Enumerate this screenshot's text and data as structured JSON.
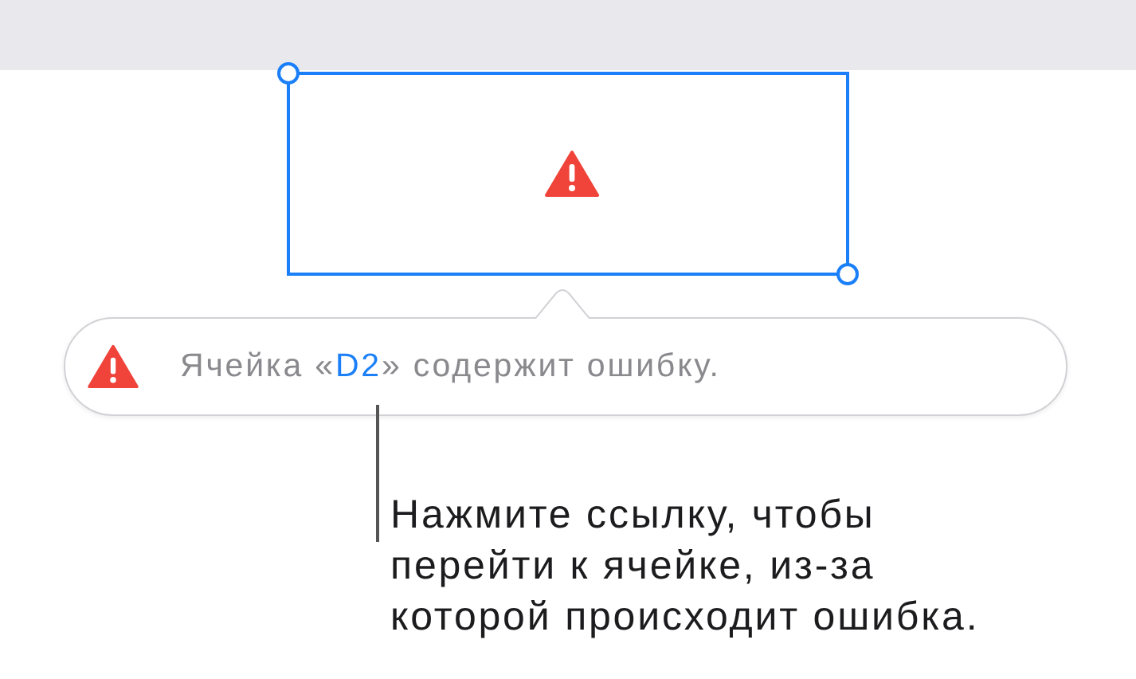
{
  "cell": {
    "error": true,
    "selected": true
  },
  "popover": {
    "message_before": "Ячейка «",
    "link": "D2",
    "message_after": "» содержит ошибку."
  },
  "callout": {
    "lines": [
      "Нажмите ссылку, чтобы",
      "перейти к ячейке, из-за",
      "которой происходит ошибка."
    ]
  }
}
